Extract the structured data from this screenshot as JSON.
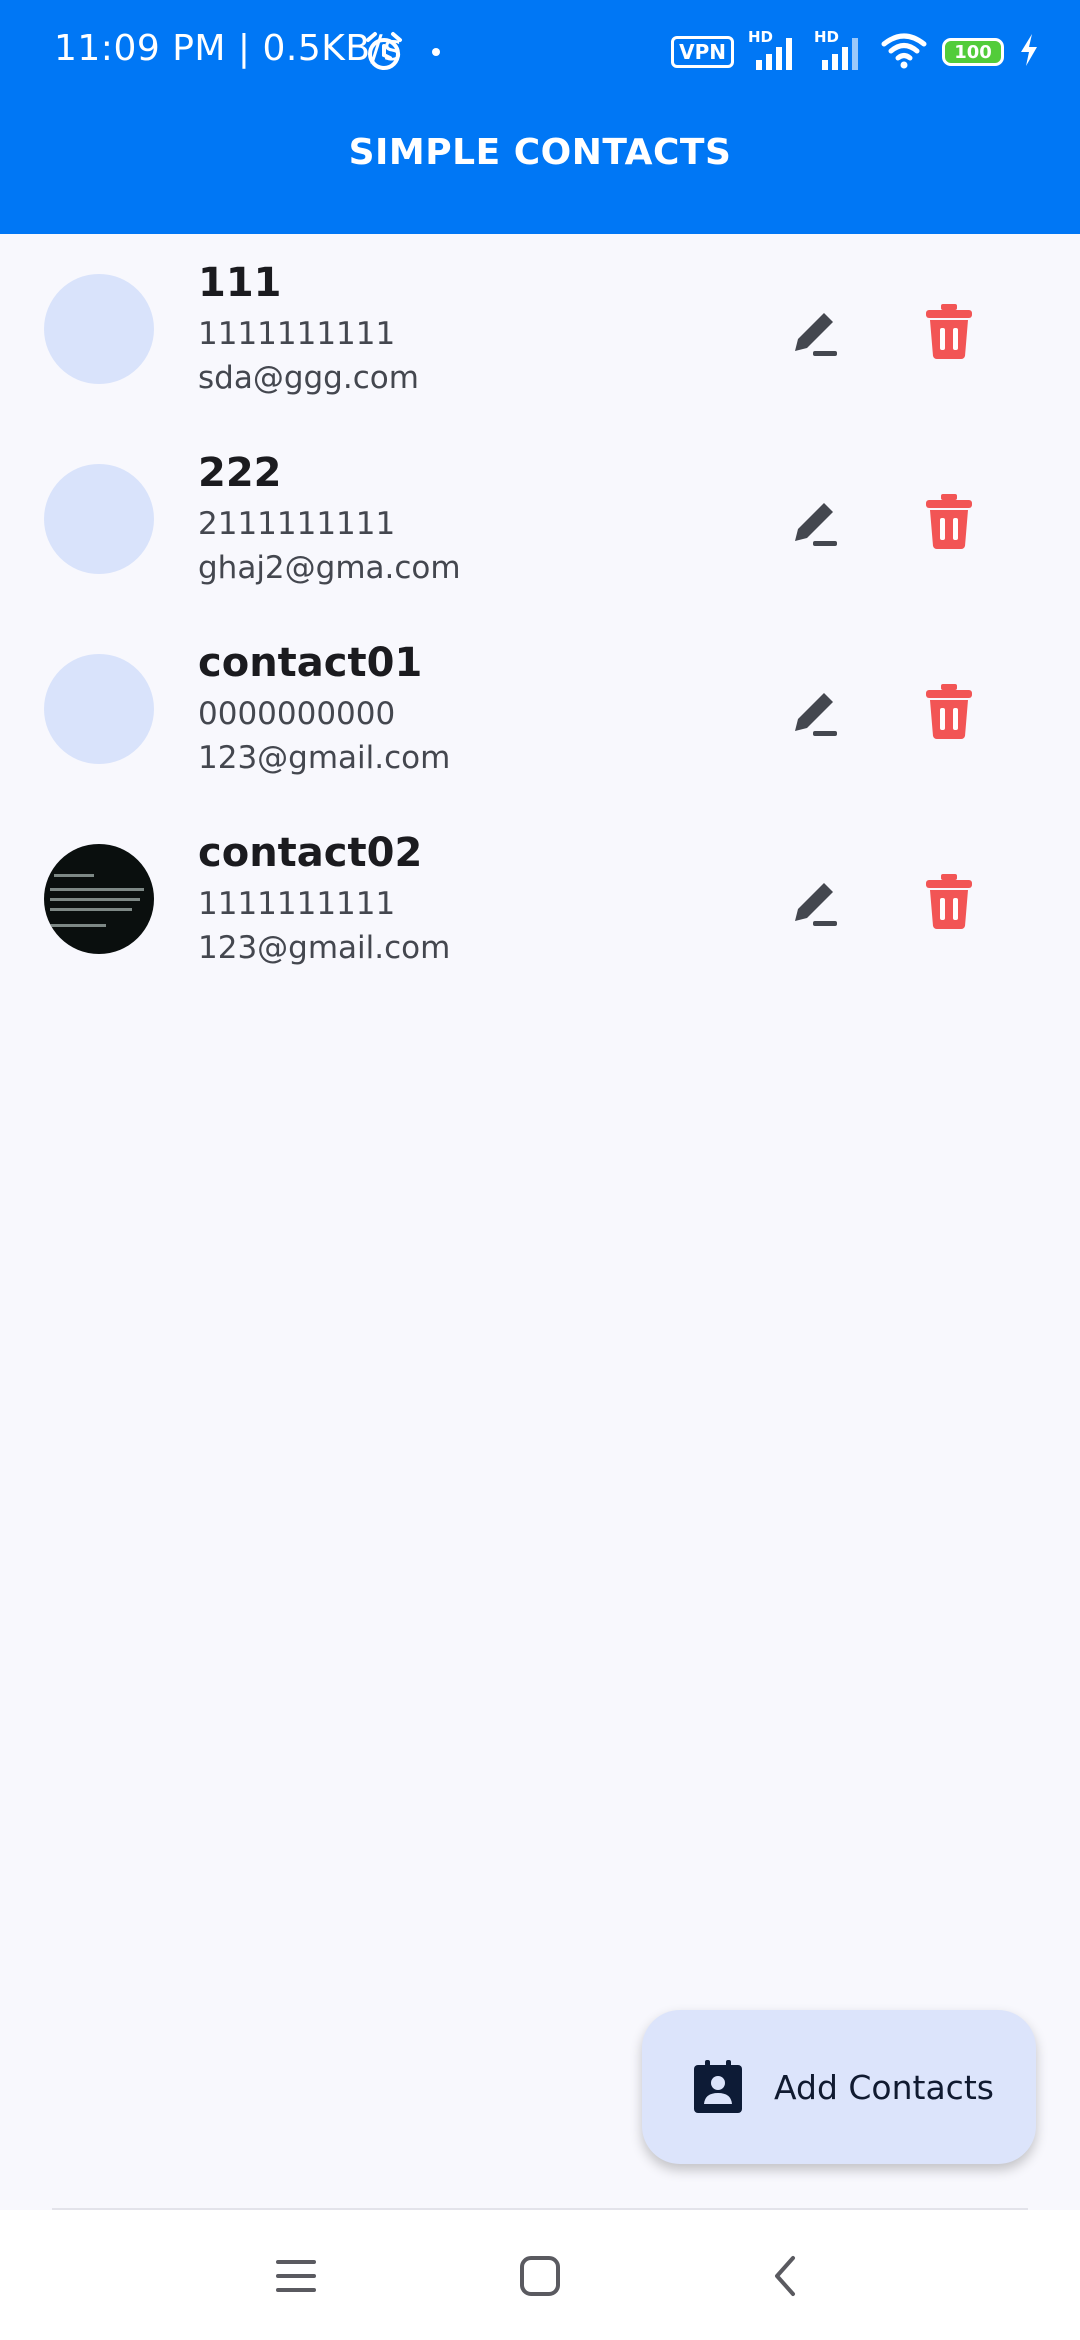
{
  "status_bar": {
    "time_speed": "11:09 PM | 0.5KB/s",
    "vpn": "VPN",
    "signal_label_1": "HD",
    "signal_label_2": "HD",
    "battery": "100"
  },
  "header": {
    "title": "SIMPLE CONTACTS"
  },
  "contacts": [
    {
      "name": "111",
      "phone": "1111111111",
      "email": "sda@ggg.com",
      "avatar": "placeholder"
    },
    {
      "name": "222",
      "phone": "2111111111",
      "email": "ghaj2@gma.com",
      "avatar": "placeholder"
    },
    {
      "name": "contact01",
      "phone": "0000000000",
      "email": "123@gmail.com",
      "avatar": "placeholder"
    },
    {
      "name": "contact02",
      "phone": "1111111111",
      "email": "123@gmail.com",
      "avatar": "photo"
    }
  ],
  "fab": {
    "label": "Add Contacts",
    "icon": "contact-book-icon"
  },
  "colors": {
    "header": "#0077f5",
    "avatar_placeholder": "#d9e3fb",
    "delete": "#f25555",
    "edit": "#44474f",
    "fab_bg": "#dce4fb"
  },
  "nav": {
    "icons": [
      "menu-icon",
      "home-icon",
      "back-icon"
    ]
  }
}
